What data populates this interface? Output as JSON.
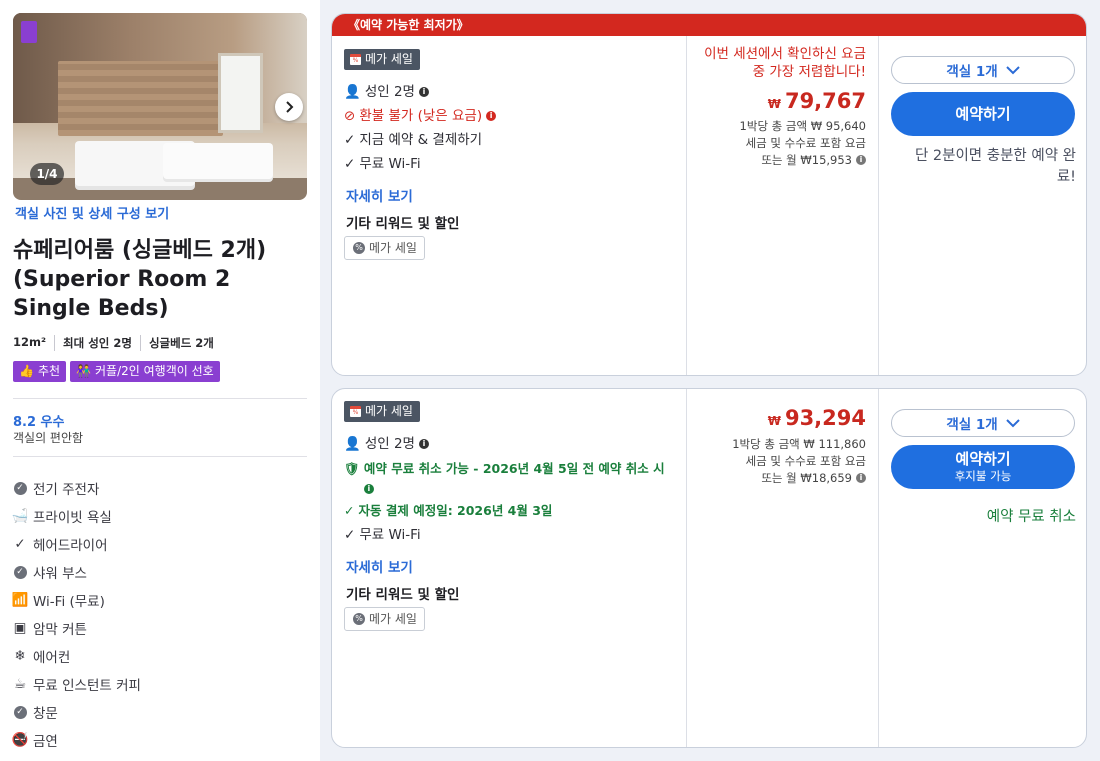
{
  "room": {
    "photo_counter": "1/4",
    "photo_link": "객실 사진 및 상세 구성 보기",
    "title": "슈페리어룸 (싱글베드 2개) (Superior Room 2 Single Beds)",
    "specs": [
      "12m²",
      "최대 성인 2명",
      "싱글베드 2개"
    ],
    "tags": [
      "추천",
      "커플/2인 여행객이 선호"
    ],
    "score": "8.2 우수",
    "score_sub": "객실의 편안함",
    "amenities": [
      {
        "label": "전기 주전자",
        "icon": "check-circle-icon"
      },
      {
        "label": "프라이빗 욕실",
        "icon": "bathtub-icon"
      },
      {
        "label": "헤어드라이어",
        "icon": "check-icon"
      },
      {
        "label": "샤워 부스",
        "icon": "check-circle-icon"
      },
      {
        "label": "Wi-Fi (무료)",
        "icon": "wifi-icon"
      },
      {
        "label": "암막 커튼",
        "icon": "curtain-icon"
      },
      {
        "label": "에어컨",
        "icon": "snowflake-icon"
      },
      {
        "label": "무료 인스턴트 커피",
        "icon": "coffee-icon"
      },
      {
        "label": "창문",
        "icon": "check-circle-icon"
      },
      {
        "label": "금연",
        "icon": "no-smoking-icon"
      }
    ]
  },
  "offer1": {
    "ribbon": "《예약 가능한 최저가》",
    "badge": "메가 세일",
    "guests": "성인 2명",
    "refund": "환불 불가 (낮은 요금)",
    "pay_now": "지금 예약 & 결제하기",
    "wifi": "무료 Wi-Fi",
    "details": "자세히 보기",
    "other": "기타 리워드 및 할인",
    "other_badge": "메가 세일",
    "urgency": "이번 세션에서 확인하신 요금 중 가장 저렴합니다!",
    "currency": "₩",
    "price": "79,767",
    "per_night": "1박당 총 금액 ₩ 95,640",
    "tax_note": "세금 및 수수료 포함 요금",
    "monthly": "또는 월 ₩15,953",
    "room_select": "객실 1개",
    "book": "예약하기",
    "note": "단 2분이면 충분한 예약 완료!"
  },
  "offer2": {
    "badge": "메가 세일",
    "guests": "성인 2명",
    "cancel": "예약 무료 취소 가능 - 2026년 4월 5일 전 예약 취소 시",
    "auto_pay": "자동 결제 예정일: 2026년 4월 3일",
    "wifi": "무료 Wi-Fi",
    "details": "자세히 보기",
    "other": "기타 리워드 및 할인",
    "other_badge": "메가 세일",
    "currency": "₩",
    "price": "93,294",
    "per_night": "1박당 총 금액 ₩ 111,860",
    "tax_note": "세금 및 수수료 포함 요금",
    "monthly": "또는 월 ₩18,659",
    "room_select": "객실 1개",
    "book": "예약하기",
    "book_sub": "후지불 가능",
    "note": "예약 무료 취소"
  },
  "colors": {
    "accent": "#1f6fe0",
    "price_red": "#c8281f",
    "purple": "#8a3fd1",
    "green": "#1a7f3c"
  }
}
